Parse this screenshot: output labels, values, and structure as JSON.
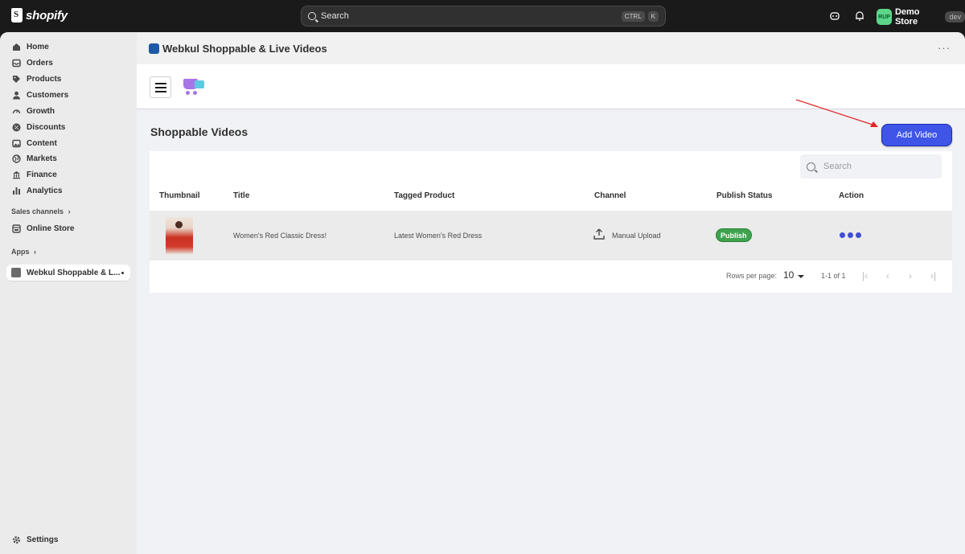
{
  "topbar": {
    "logo_text": "shopify",
    "search_label": "Search",
    "shortcut_keys": [
      "CTRL",
      "K"
    ],
    "store_initials": "RUP",
    "store_name": "Demo Store",
    "store_badge": "dev"
  },
  "sidebar": {
    "items": [
      {
        "label": "Home",
        "icon": "home-icon"
      },
      {
        "label": "Orders",
        "icon": "inbox-icon"
      },
      {
        "label": "Products",
        "icon": "tag-icon"
      },
      {
        "label": "Customers",
        "icon": "person-icon"
      },
      {
        "label": "Growth",
        "icon": "gauge-icon"
      },
      {
        "label": "Discounts",
        "icon": "discount-icon"
      },
      {
        "label": "Content",
        "icon": "image-icon"
      },
      {
        "label": "Markets",
        "icon": "globe-icon"
      },
      {
        "label": "Finance",
        "icon": "bank-icon"
      },
      {
        "label": "Analytics",
        "icon": "bar-chart-icon"
      }
    ],
    "sales_channels_label": "Sales channels",
    "online_store_label": "Online Store",
    "apps_label": "Apps",
    "active_app_label": "Webkul Shoppable & L...",
    "settings_label": "Settings"
  },
  "app": {
    "title": "Webkul Shoppable & Live Videos",
    "page_title": "Shoppable Videos",
    "add_button": "Add Video",
    "search_placeholder": "Search",
    "columns": [
      "Thumbnail",
      "Title",
      "Tagged Product",
      "Channel",
      "Publish Status",
      "Action"
    ],
    "rows": [
      {
        "title": "Women's Red Classic Dress!",
        "tagged_product": "Latest Women's Red Dress",
        "channel": "Manual Upload",
        "status": "Publish"
      }
    ],
    "pagination": {
      "rows_per_page_label": "Rows per page:",
      "rows_per_page_value": "10",
      "range": "1-1 of 1"
    }
  },
  "colors": {
    "accent": "#3e55e8",
    "publish": "#3fa34d",
    "arrow": "#e02424"
  }
}
